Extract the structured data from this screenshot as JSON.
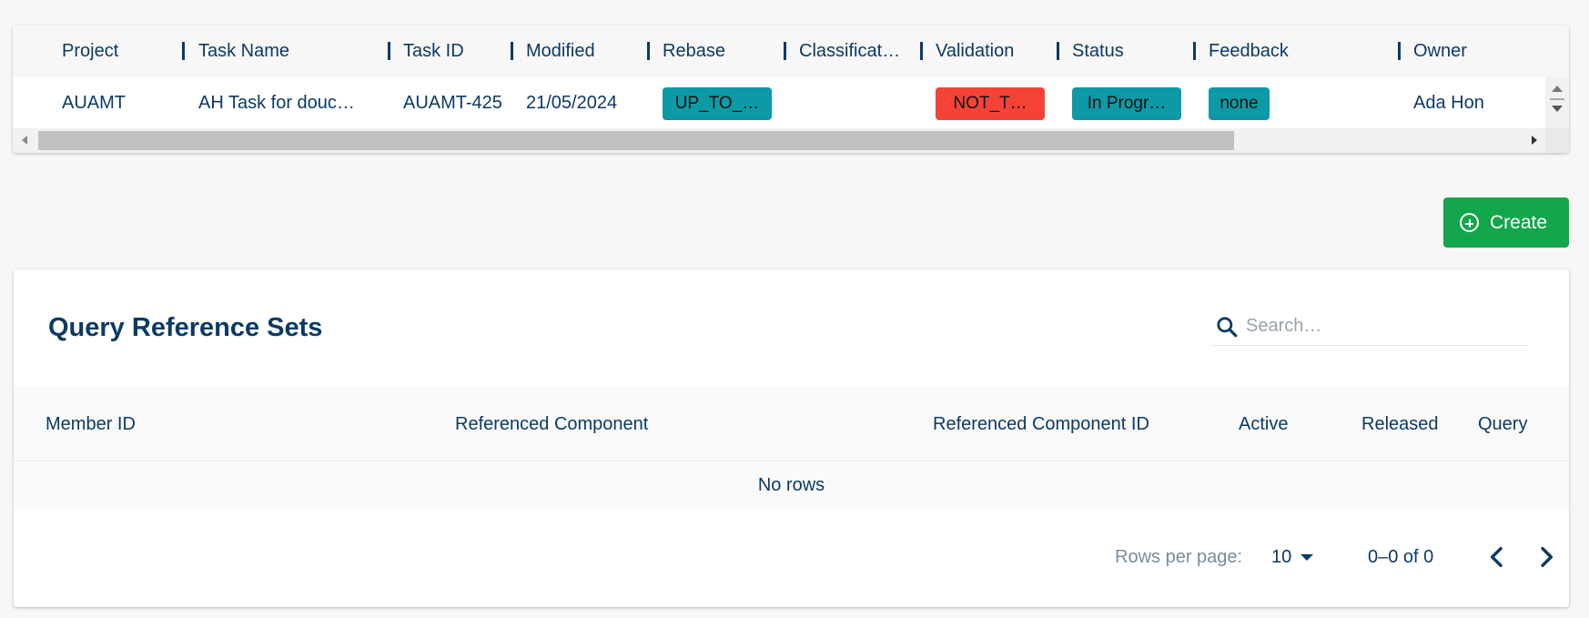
{
  "task_table": {
    "columns": [
      "Project",
      "Task Name",
      "Task ID",
      "Modified",
      "Rebase",
      "Classificat…",
      "Validation",
      "Status",
      "Feedback",
      "Owner"
    ],
    "row": {
      "project": "AUAMT",
      "task_name": "AH Task for douc…",
      "task_id": "AUAMT-425",
      "modified": "21/05/2024",
      "rebase": "UP_TO_…",
      "classification": "",
      "validation": "NOT_T…",
      "status": "In Progr…",
      "feedback": "none",
      "owner": "Ada Hon"
    }
  },
  "create_button": {
    "label": "Create"
  },
  "query_reference_sets": {
    "title": "Query Reference Sets",
    "search": {
      "placeholder": "Search…",
      "value": ""
    },
    "columns": [
      "Member ID",
      "Referenced Component",
      "Referenced Component ID",
      "Active",
      "Released",
      "Query"
    ],
    "empty_text": "No rows",
    "pagination": {
      "rows_per_page_label": "Rows per page:",
      "rows_per_page": "10",
      "range": "0–0 of 0"
    }
  },
  "colors": {
    "primary_text": "#0b3a66",
    "chip_teal": "#0d9aa6",
    "chip_red": "#f44336",
    "create_green": "#14a64a"
  },
  "icons": [
    "search-icon",
    "add-circle-icon",
    "chevron-left-icon",
    "chevron-right-icon",
    "caret-down-icon"
  ]
}
